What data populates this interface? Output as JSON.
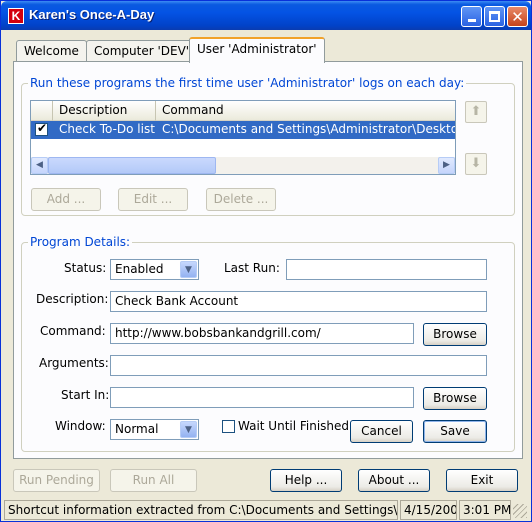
{
  "window": {
    "title": "Karen's Once-A-Day",
    "icon_letter": "K",
    "controls": {
      "minimize": "minimize-icon",
      "maximize": "maximize-icon",
      "close": "✕"
    }
  },
  "tabs": [
    {
      "label": "Welcome",
      "active": false
    },
    {
      "label": "Computer 'DEV'",
      "active": false
    },
    {
      "label": "User 'Administrator'",
      "active": true
    }
  ],
  "programs_group": {
    "legend": "Run these programs the first time user 'Administrator' logs on each day:",
    "columns": [
      "Description",
      "Command"
    ],
    "rows": [
      {
        "checked": true,
        "description": "Check To-Do list",
        "command": "C:\\Documents and Settings\\Administrator\\Desktop\\To"
      }
    ],
    "buttons": {
      "add": "Add ...",
      "edit": "Edit ...",
      "delete": "Delete ..."
    },
    "move_up_icon": "arrow-up-icon",
    "move_down_icon": "arrow-down-icon"
  },
  "details_group": {
    "legend": "Program Details:",
    "status_label": "Status:",
    "status_value": "Enabled",
    "last_run_label": "Last Run:",
    "last_run_value": "",
    "description_label": "Description:",
    "description_value": "Check Bank Account",
    "command_label": "Command:",
    "command_value": "http://www.bobsbankandgrill.com/",
    "arguments_label": "Arguments:",
    "arguments_value": "",
    "start_in_label": "Start In:",
    "start_in_value": "",
    "window_label": "Window:",
    "window_value": "Normal",
    "wait_label": "Wait Until Finished",
    "wait_checked": false,
    "browse_label": "Browse",
    "cancel_label": "Cancel",
    "save_label": "Save"
  },
  "footer": {
    "run_pending": "Run Pending",
    "run_all": "Run All",
    "help": "Help ...",
    "about": "About ...",
    "exit": "Exit"
  },
  "statusbar": {
    "message": "Shortcut information extracted from C:\\Documents and Settings\\Administ",
    "date": "4/15/2005",
    "time": "3:01 PM"
  },
  "colors": {
    "title_blue": "#0453e4",
    "selection": "#316ac5",
    "legend_blue": "#0046d5",
    "face": "#ece9d8"
  }
}
